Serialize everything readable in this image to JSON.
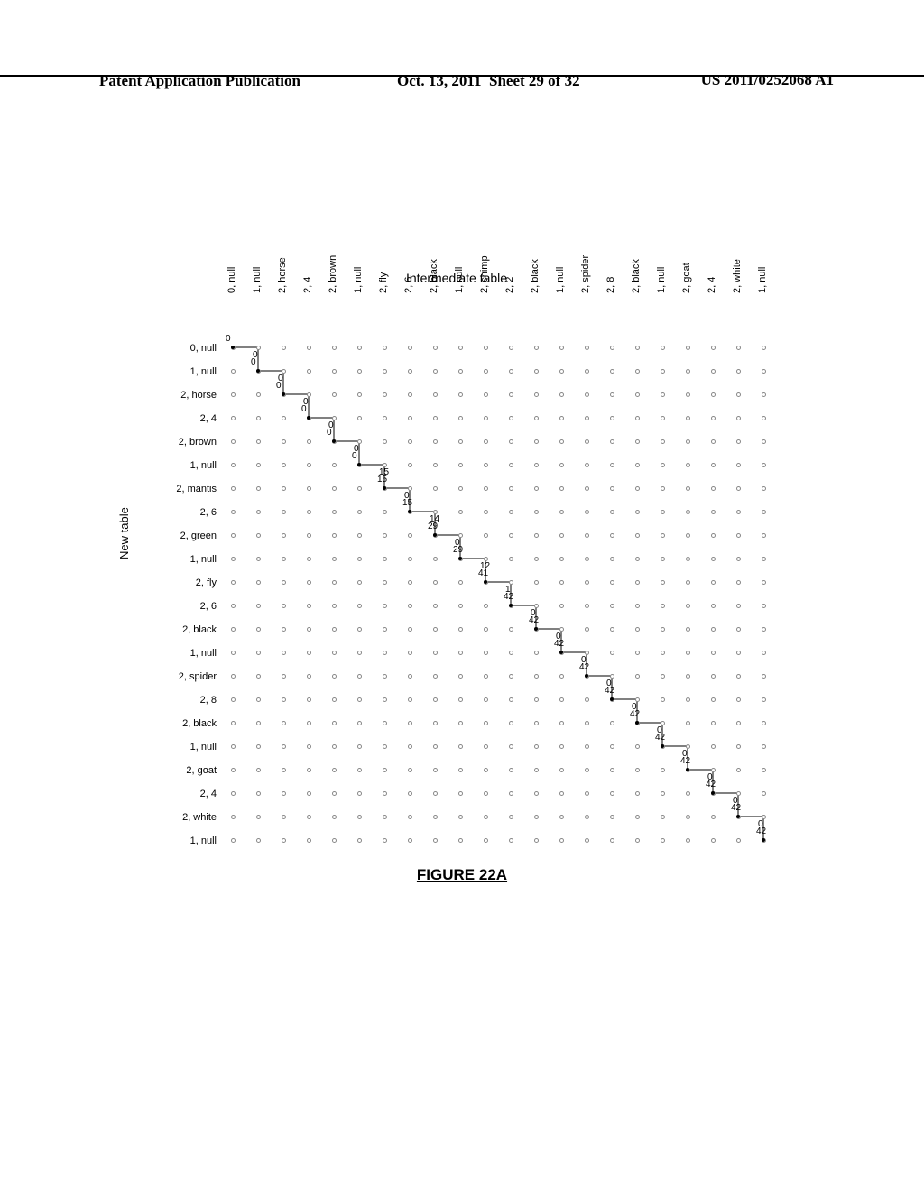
{
  "header": {
    "left": "Patent Application Publication",
    "date": "Oct. 13, 2011",
    "sheet": "Sheet 29 of 32",
    "pub": "US 2011/0252068 A1"
  },
  "figure": {
    "top_title": "Intermediate table",
    "side_title": "New table",
    "caption": "FIGURE 22A",
    "col_labels": [
      "0, null",
      "1, null",
      "2, horse",
      "2, 4",
      "2, brown",
      "1, null",
      "2, fly",
      "2, 6",
      "2, black",
      "1, null",
      "2, chimp",
      "2, 2",
      "2, black",
      "1, null",
      "2, spider",
      "2, 8",
      "2, black",
      "1, null",
      "2, goat",
      "2, 4",
      "2, white",
      "1, null"
    ],
    "row_labels": [
      "0, null",
      "1, null",
      "2, horse",
      "2, 4",
      "2, brown",
      "1, null",
      "2, mantis",
      "2, 6",
      "2, green",
      "1, null",
      "2, fly",
      "2, 6",
      "2, black",
      "1, null",
      "2, spider",
      "2, 8",
      "2, black",
      "1, null",
      "2, goat",
      "2, 4",
      "2, white",
      "1, null"
    ],
    "diag_values": [
      "0",
      "0",
      "0",
      "0",
      "0",
      "0",
      "15",
      "15",
      "29",
      "29",
      "41",
      "42",
      "42",
      "42",
      "42",
      "42",
      "42",
      "42",
      "42",
      "42",
      "42",
      "42"
    ],
    "off_diag": [
      {
        "r": 0,
        "c": 1,
        "v": "0"
      },
      {
        "r": 1,
        "c": 2,
        "v": "0"
      },
      {
        "r": 2,
        "c": 3,
        "v": "0"
      },
      {
        "r": 3,
        "c": 4,
        "v": "0"
      },
      {
        "r": 4,
        "c": 5,
        "v": "0"
      },
      {
        "r": 5,
        "c": 6,
        "v": "15"
      },
      {
        "r": 6,
        "c": 7,
        "v": "0"
      },
      {
        "r": 7,
        "c": 8,
        "v": "14"
      },
      {
        "r": 8,
        "c": 9,
        "v": "0"
      },
      {
        "r": 9,
        "c": 10,
        "v": "12"
      },
      {
        "r": 10,
        "c": 11,
        "v": "1"
      },
      {
        "r": 11,
        "c": 12,
        "v": "0"
      },
      {
        "r": 12,
        "c": 13,
        "v": "0"
      },
      {
        "r": 13,
        "c": 14,
        "v": "0"
      },
      {
        "r": 14,
        "c": 15,
        "v": "0"
      },
      {
        "r": 15,
        "c": 16,
        "v": "0"
      },
      {
        "r": 16,
        "c": 17,
        "v": "0"
      },
      {
        "r": 17,
        "c": 18,
        "v": "0"
      },
      {
        "r": 18,
        "c": 19,
        "v": "0"
      },
      {
        "r": 19,
        "c": 20,
        "v": "0"
      },
      {
        "r": 20,
        "c": 21,
        "v": "0"
      }
    ]
  },
  "chart_data": {
    "type": "heatmap",
    "title": "FIGURE 22A",
    "xlabel": "Intermediate table",
    "ylabel": "New table",
    "x_categories": [
      "0, null",
      "1, null",
      "2, horse",
      "2, 4",
      "2, brown",
      "1, null",
      "2, fly",
      "2, 6",
      "2, black",
      "1, null",
      "2, chimp",
      "2, 2",
      "2, black",
      "1, null",
      "2, spider",
      "2, 8",
      "2, black",
      "1, null",
      "2, goat",
      "2, 4",
      "2, white",
      "1, null"
    ],
    "y_categories": [
      "0, null",
      "1, null",
      "2, horse",
      "2, 4",
      "2, brown",
      "1, null",
      "2, mantis",
      "2, 6",
      "2, green",
      "1, null",
      "2, fly",
      "2, 6",
      "2, black",
      "1, null",
      "2, spider",
      "2, 8",
      "2, black",
      "1, null",
      "2, goat",
      "2, 4",
      "2, white",
      "1, null"
    ],
    "diagonal_path_values": [
      0,
      0,
      0,
      0,
      0,
      0,
      15,
      15,
      29,
      29,
      41,
      42,
      42,
      42,
      42,
      42,
      42,
      42,
      42,
      42,
      42,
      42
    ],
    "upper_off_diagonal_values": [
      0,
      0,
      0,
      0,
      0,
      15,
      0,
      14,
      0,
      12,
      1,
      0,
      0,
      0,
      0,
      0,
      0,
      0,
      0,
      0,
      0
    ]
  }
}
